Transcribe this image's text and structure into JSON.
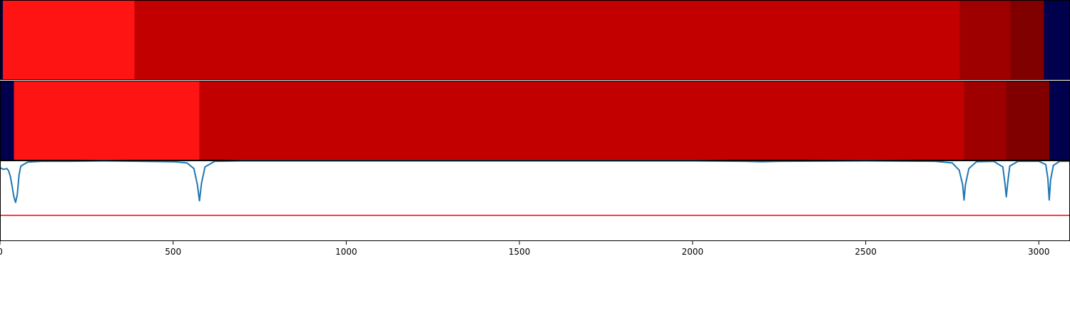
{
  "chart_data": [
    {
      "type": "heatmap",
      "x": {
        "min": 0,
        "max": 3090
      },
      "segments": [
        {
          "start": 0,
          "end": 8,
          "color": "#00004c"
        },
        {
          "start": 8,
          "end": 388,
          "color": "#ff1414"
        },
        {
          "start": 388,
          "end": 2772,
          "color": "#c20000"
        },
        {
          "start": 2772,
          "end": 2918,
          "color": "#9e0000"
        },
        {
          "start": 2918,
          "end": 3015,
          "color": "#800000"
        },
        {
          "start": 3015,
          "end": 3090,
          "color": "#00004c"
        }
      ]
    },
    {
      "type": "heatmap",
      "x": {
        "min": 0,
        "max": 3090
      },
      "segments": [
        {
          "start": 0,
          "end": 40,
          "color": "#00004c"
        },
        {
          "start": 40,
          "end": 576,
          "color": "#ff1414"
        },
        {
          "start": 576,
          "end": 2784,
          "color": "#c20000"
        },
        {
          "start": 2784,
          "end": 2906,
          "color": "#9e0000"
        },
        {
          "start": 2906,
          "end": 3030,
          "color": "#800000"
        },
        {
          "start": 3030,
          "end": 3090,
          "color": "#00004c"
        }
      ]
    },
    {
      "type": "line",
      "xlim": [
        0,
        3090
      ],
      "ylim": [
        0,
        1
      ],
      "xticks": [
        0,
        500,
        1000,
        1500,
        2000,
        2500,
        3000
      ],
      "line_color": "#1f77b4",
      "threshold": {
        "y": 0.32,
        "color": "#ff0000"
      },
      "series": [
        {
          "x": [
            0,
            10,
            20,
            25,
            30,
            35,
            40,
            45,
            50,
            55,
            60,
            80,
            120,
            200,
            300,
            400,
            500,
            540,
            560,
            570,
            576,
            582,
            592,
            620,
            700,
            1000,
            1500,
            2000,
            2150,
            2200,
            2250,
            2500,
            2700,
            2750,
            2770,
            2780,
            2784,
            2788,
            2798,
            2820,
            2870,
            2896,
            2902,
            2906,
            2910,
            2916,
            2940,
            3000,
            3020,
            3026,
            3030,
            3034,
            3042,
            3060,
            3090
          ],
          "y": [
            0.91,
            0.89,
            0.9,
            0.87,
            0.8,
            0.68,
            0.55,
            0.48,
            0.58,
            0.82,
            0.93,
            0.98,
            0.99,
            0.99,
            0.995,
            0.99,
            0.985,
            0.97,
            0.9,
            0.7,
            0.5,
            0.72,
            0.92,
            0.99,
            0.995,
            0.995,
            0.995,
            0.995,
            0.99,
            0.985,
            0.99,
            0.995,
            0.99,
            0.97,
            0.88,
            0.7,
            0.51,
            0.7,
            0.9,
            0.985,
            0.99,
            0.92,
            0.72,
            0.55,
            0.72,
            0.93,
            0.99,
            0.99,
            0.95,
            0.78,
            0.51,
            0.76,
            0.94,
            0.99,
            0.99
          ]
        }
      ]
    }
  ]
}
